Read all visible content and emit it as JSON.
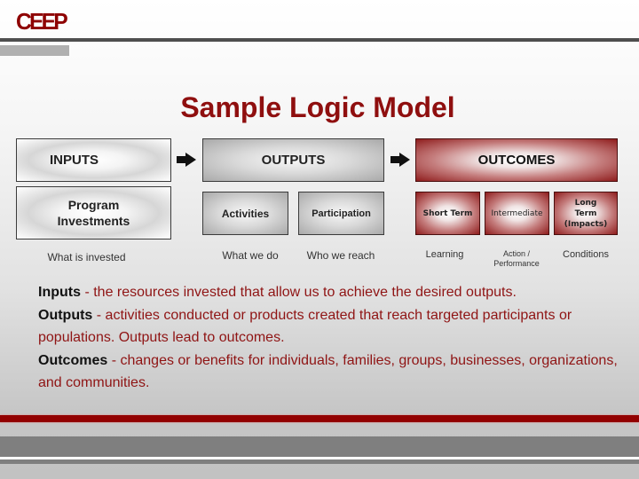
{
  "logo": {
    "text": "CEEP"
  },
  "title": "Sample Logic Model",
  "diagram": {
    "inputs": {
      "header": "INPUTS",
      "items": [
        {
          "label": "Program Investments"
        }
      ],
      "captions": [
        "What is invested"
      ]
    },
    "outputs": {
      "header": "OUTPUTS",
      "items": [
        {
          "label": "Activities"
        },
        {
          "label": "Participation"
        }
      ],
      "captions": [
        "What we do",
        "Who we reach"
      ]
    },
    "outcomes": {
      "header": "OUTCOMES",
      "items": [
        {
          "label": "Short Term"
        },
        {
          "label": "Intermediate"
        },
        {
          "label": "Long Term (Impacts)"
        }
      ],
      "captions": [
        "Learning",
        "Action / Performance",
        "Conditions"
      ]
    },
    "arrows": [
      "arrow-right-icon",
      "arrow-right-icon"
    ]
  },
  "definitions": [
    {
      "term": "Inputs",
      "sep": " - ",
      "text": "the resources invested that allow us to achieve the desired outputs."
    },
    {
      "term": "Outputs",
      "sep": " - ",
      "text": "activities conducted or products created that reach targeted participants or populations. Outputs lead to outcomes."
    },
    {
      "term": "Outcomes",
      "sep": " - ",
      "text": "changes or benefits for individuals, families, groups, businesses, organizations, and communities."
    }
  ],
  "colors": {
    "brand_red": "#8f0f0f",
    "footer_red": "#920000",
    "dark_gray": "#4e4e4e"
  }
}
